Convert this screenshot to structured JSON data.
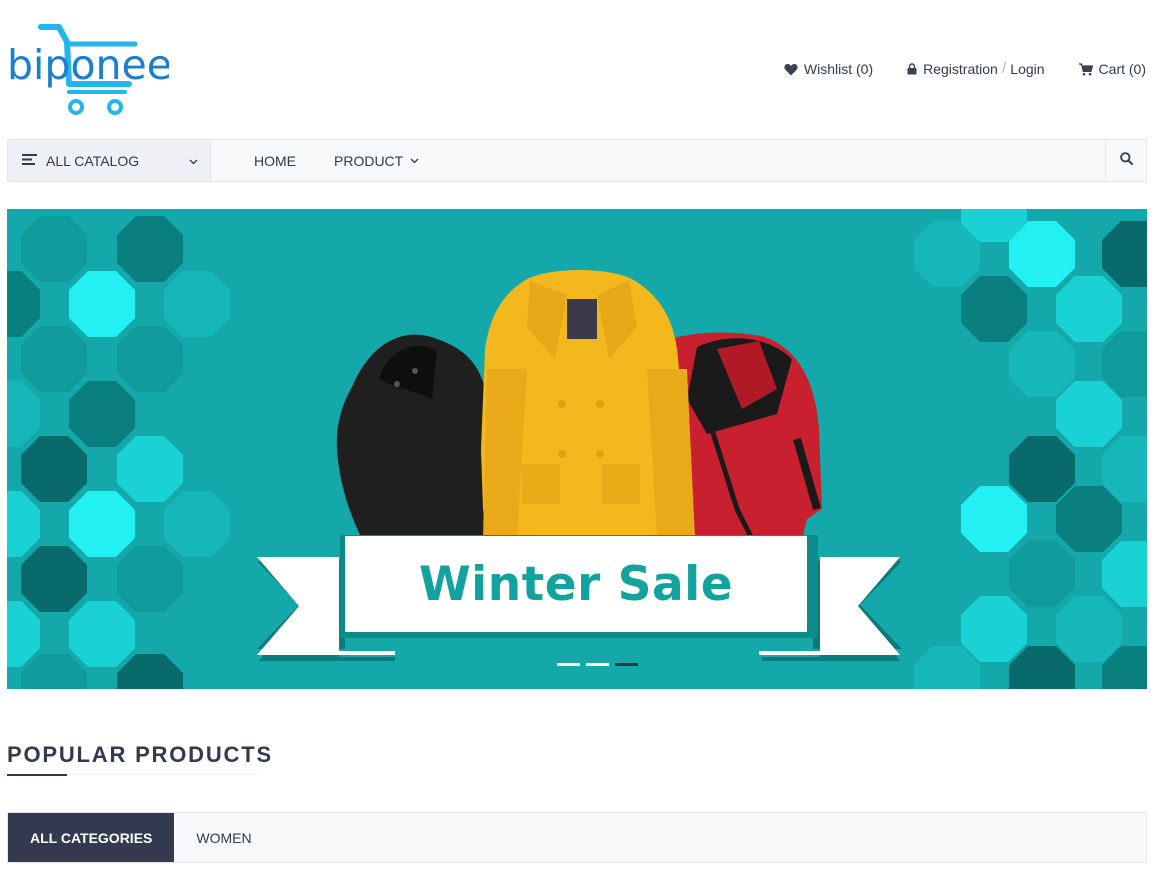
{
  "brand": {
    "name": "biponee",
    "logo_color": "#1b7fd0",
    "accent": "#22b5f0"
  },
  "header": {
    "wishlist": {
      "icon": "heart-icon",
      "label": "Wishlist (0)"
    },
    "account": {
      "icon": "lock-icon",
      "registration": "Registration",
      "separator": "/",
      "login": "Login"
    },
    "cart": {
      "icon": "cart-icon",
      "label": "Cart (0)"
    }
  },
  "nav": {
    "catalog": {
      "icon": "menu-icon",
      "label": "ALL CATALOG",
      "chevron": "chevron-down-icon"
    },
    "items": [
      {
        "label": "HOME"
      },
      {
        "label": "PRODUCT",
        "chevron": "chevron-down-icon"
      }
    ],
    "search": {
      "icon": "search-icon"
    }
  },
  "banner": {
    "title": "Winter Sale",
    "background": "#14a8aa",
    "title_color": "#12a39e",
    "slides": 3,
    "active_slide": 3
  },
  "popular": {
    "title": "POPULAR PRODUCTS",
    "tabs": [
      {
        "label": "ALL CATEGORIES",
        "active": true
      },
      {
        "label": "WOMEN",
        "active": false
      }
    ],
    "active_tab_color": "#333a50"
  }
}
